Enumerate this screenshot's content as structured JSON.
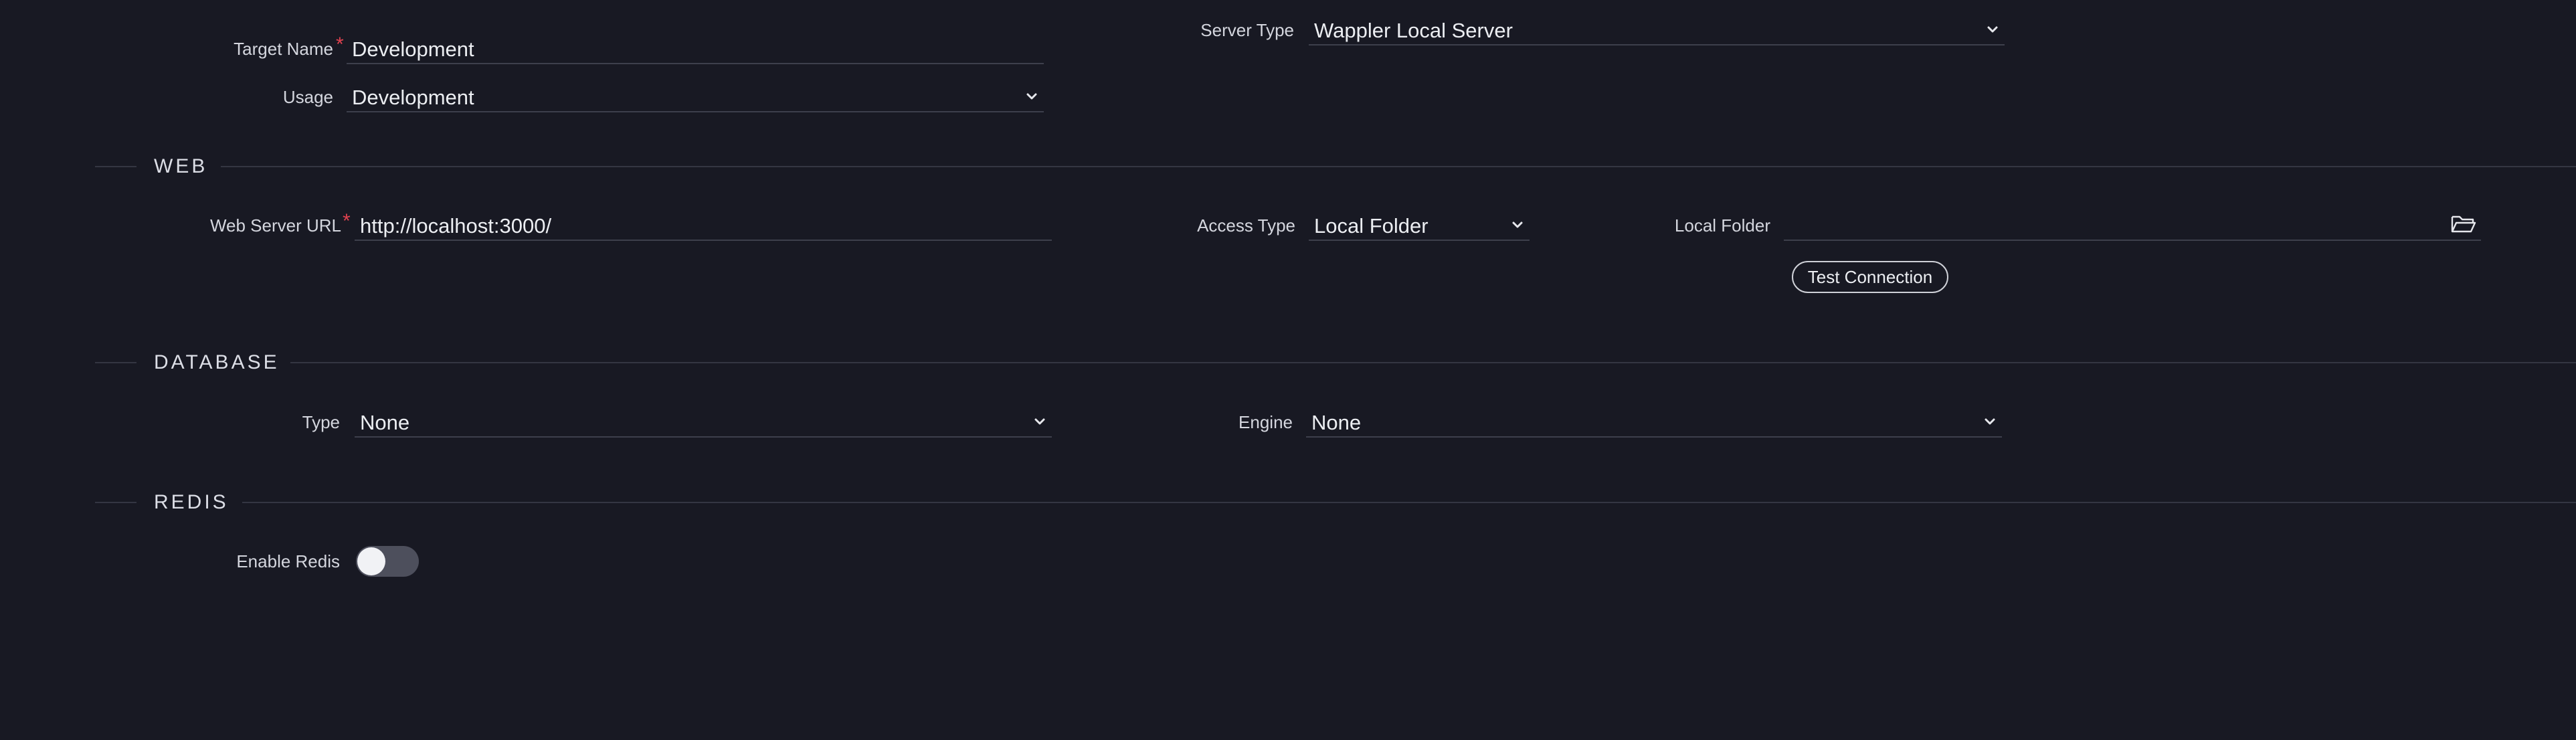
{
  "general": {
    "target_name_label": "Target Name",
    "target_name_value": "Development",
    "usage_label": "Usage",
    "usage_value": "Development",
    "server_type_label": "Server Type",
    "server_type_value": "Wappler Local Server",
    "required_mark": "*"
  },
  "web": {
    "title": "WEB",
    "url_label": "Web Server URL",
    "url_value": "http://localhost:3000/",
    "access_type_label": "Access Type",
    "access_type_value": "Local Folder",
    "local_folder_label": "Local Folder",
    "local_folder_value": "",
    "test_connection_label": "Test Connection",
    "folder_icon": "folder-open-icon"
  },
  "database": {
    "title": "DATABASE",
    "type_label": "Type",
    "type_value": "None",
    "engine_label": "Engine",
    "engine_value": "None"
  },
  "redis": {
    "title": "REDIS",
    "enable_label": "Enable Redis",
    "enabled": false
  },
  "colors": {
    "background": "#181923",
    "required": "#e0424f",
    "text": "#e6e7ec"
  }
}
